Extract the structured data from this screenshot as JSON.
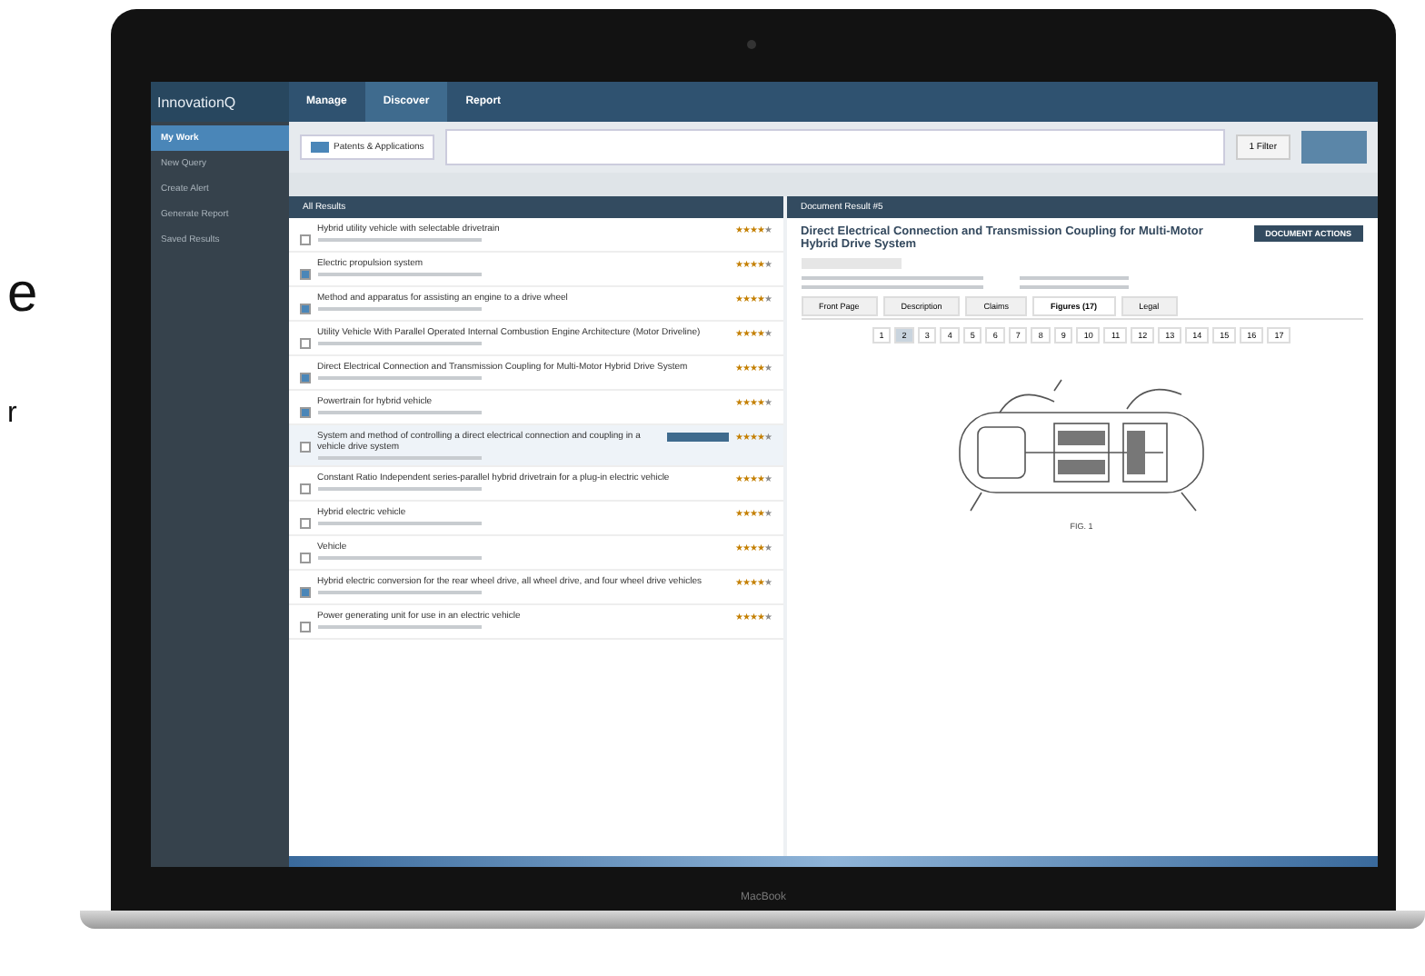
{
  "side_text": [
    "e",
    "r"
  ],
  "app": {
    "logo": "InnovationQ",
    "nav": [
      {
        "label": "Manage",
        "selected": false
      },
      {
        "label": "Discover",
        "selected": true
      },
      {
        "label": "Report",
        "selected": false
      }
    ]
  },
  "sidebar": {
    "items": [
      {
        "label": "My Work",
        "selected": true
      },
      {
        "label": "New Query",
        "selected": false
      },
      {
        "label": "Create Alert",
        "selected": false
      },
      {
        "label": "Generate Report",
        "selected": false
      },
      {
        "label": "Saved Results",
        "selected": false
      }
    ]
  },
  "search": {
    "source": "Patents & Applications",
    "filter_button": "1 Filter"
  },
  "list": {
    "header": "All Results",
    "rows": [
      {
        "title": "Hybrid utility vehicle with selectable drivetrain",
        "checked": false,
        "selected": false,
        "stars": 4
      },
      {
        "title": "Electric propulsion system",
        "checked": true,
        "selected": false,
        "stars": 4
      },
      {
        "title": "Method and apparatus for assisting an engine to a drive wheel",
        "checked": true,
        "selected": false,
        "stars": 4
      },
      {
        "title": "Utility Vehicle With Parallel Operated Internal Combustion Engine Architecture (Motor Driveline)",
        "checked": false,
        "selected": false,
        "stars": 4
      },
      {
        "title": "Direct Electrical Connection and Transmission Coupling for Multi-Motor Hybrid Drive System",
        "checked": true,
        "selected": false,
        "stars": 4
      },
      {
        "title": "Powertrain for hybrid vehicle",
        "checked": true,
        "selected": false,
        "stars": 4
      },
      {
        "title": "System and method of controlling a direct electrical connection and coupling in a vehicle drive system",
        "checked": false,
        "selected": true,
        "stars": 4
      },
      {
        "title": "Constant Ratio Independent series-parallel hybrid drivetrain for a plug-in electric vehicle",
        "checked": false,
        "selected": false,
        "stars": 4
      },
      {
        "title": "Hybrid electric vehicle",
        "checked": false,
        "selected": false,
        "stars": 4
      },
      {
        "title": "Vehicle",
        "checked": false,
        "selected": false,
        "stars": 4
      },
      {
        "title": "Hybrid electric conversion for the rear wheel drive, all wheel drive, and four wheel drive vehicles",
        "checked": true,
        "selected": false,
        "stars": 4
      },
      {
        "title": "Power generating unit for use in an electric vehicle",
        "checked": false,
        "selected": false,
        "stars": 4
      }
    ]
  },
  "document": {
    "header": "Document Result #5",
    "title": "Direct Electrical Connection and Transmission Coupling for Multi-Motor Hybrid Drive System",
    "actions": "DOCUMENT ACTIONS",
    "tabs": [
      {
        "label": "Front Page",
        "selected": false
      },
      {
        "label": "Description",
        "selected": false
      },
      {
        "label": "Claims",
        "selected": false
      },
      {
        "label": "Figures (17)",
        "selected": true
      },
      {
        "label": "Legal",
        "selected": false
      }
    ],
    "pages": [
      {
        "label": "1",
        "selected": false
      },
      {
        "label": "2",
        "selected": true
      },
      {
        "label": "3",
        "selected": false
      },
      {
        "label": "4",
        "selected": false
      },
      {
        "label": "5",
        "selected": false
      },
      {
        "label": "6",
        "selected": false
      },
      {
        "label": "7",
        "selected": false
      },
      {
        "label": "8",
        "selected": false
      },
      {
        "label": "9",
        "selected": false
      },
      {
        "label": "10",
        "selected": false
      },
      {
        "label": "11",
        "selected": false
      },
      {
        "label": "12",
        "selected": false
      },
      {
        "label": "13",
        "selected": false
      },
      {
        "label": "14",
        "selected": false
      },
      {
        "label": "15",
        "selected": false
      },
      {
        "label": "16",
        "selected": false
      },
      {
        "label": "17",
        "selected": false
      }
    ],
    "caption": "FIG. 1"
  },
  "device_label": "MacBook"
}
